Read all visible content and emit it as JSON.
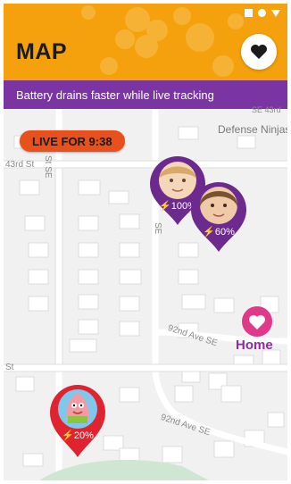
{
  "header": {
    "title": "MAP",
    "favorite_icon": "heart-icon"
  },
  "banner": {
    "text": "Battery drains faster while live tracking"
  },
  "live": {
    "label": "LIVE FOR 9:38"
  },
  "map": {
    "streets": [
      "43rd St",
      "St SE",
      "SE",
      "92nd Ave SE",
      "St",
      "92nd Ave SE",
      "SE 43rd"
    ],
    "places": [
      "Defense Ninjas",
      "Home"
    ]
  },
  "markers": [
    {
      "battery": "100%",
      "color": "#6c2a8f"
    },
    {
      "battery": "60%",
      "color": "#6c2a8f"
    },
    {
      "battery": "20%",
      "color": "#e0242f"
    }
  ],
  "colors": {
    "accent": "#f5a10d",
    "banner": "#7b35a3",
    "live": "#e8501c",
    "home": "#e0398a"
  }
}
